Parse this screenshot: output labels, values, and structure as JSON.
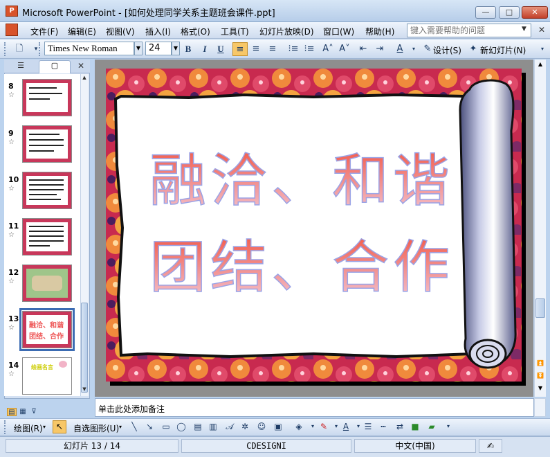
{
  "window": {
    "title": "Microsoft PowerPoint - [如何处理同学关系主题班会课件.ppt]",
    "app_icon": "P",
    "controls": {
      "minimize": "—",
      "maximize": "□",
      "close": "✕"
    }
  },
  "menu": {
    "items": [
      "文件(F)",
      "编辑(E)",
      "视图(V)",
      "插入(I)",
      "格式(O)",
      "工具(T)",
      "幻灯片放映(D)",
      "窗口(W)",
      "帮助(H)"
    ],
    "help_placeholder": "键入需要帮助的问题"
  },
  "toolbar": {
    "font_name": "Times New Roman",
    "font_size": "24",
    "bold": "B",
    "italic": "I",
    "underline": "U",
    "design_label": "设计(S)",
    "new_slide_label": "新幻灯片(N)"
  },
  "left_pane": {
    "tab_outline_icon": "outline-icon",
    "tab_slides_icon": "slides-icon",
    "slides": [
      {
        "number": "8"
      },
      {
        "number": "9"
      },
      {
        "number": "10"
      },
      {
        "number": "11"
      },
      {
        "number": "12"
      },
      {
        "number": "13",
        "selected": true,
        "thumb_line1": "融洽、和谐",
        "thumb_line2": "团结、合作"
      },
      {
        "number": "14",
        "thumb_text": "绘画名言"
      }
    ]
  },
  "slide": {
    "line1": "融洽、和谐",
    "line2": "团结、合作"
  },
  "notes": {
    "placeholder": "单击此处添加备注"
  },
  "draw_toolbar": {
    "draw_label": "绘图(R)",
    "autoshapes_label": "自选图形(U)"
  },
  "status": {
    "slide_info": "幻灯片 13 / 14",
    "template": "CDESIGNI",
    "language": "中文(中国)"
  },
  "colors": {
    "accent": "#f7c768",
    "title_bar": "#b6cde9",
    "slide_text": "#e8453c"
  }
}
